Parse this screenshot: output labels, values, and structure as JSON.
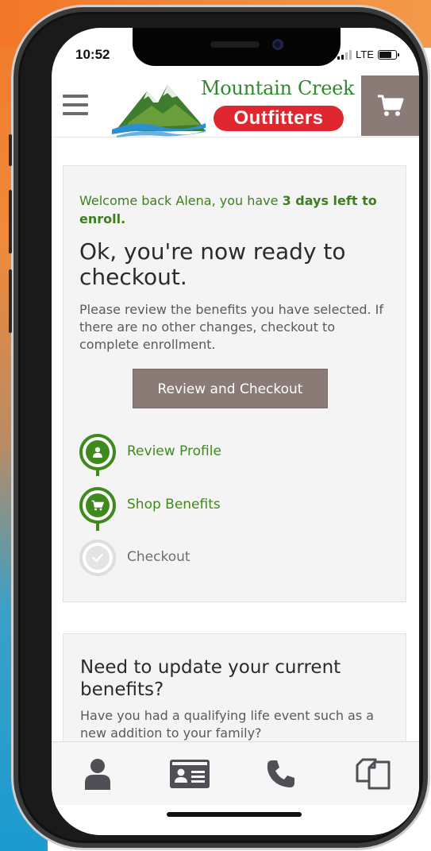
{
  "status_bar": {
    "time": "10:52",
    "network": "LTE"
  },
  "header": {
    "brand_name": "Mountain Creek",
    "brand_sub": "Outfitters",
    "menu_icon": "hamburger-icon",
    "cart_icon": "cart-icon"
  },
  "enroll_card": {
    "welcome_prefix": "Welcome back Alena, you have ",
    "welcome_bold": "3 days left to enroll.",
    "title": "Ok, you're now ready to checkout.",
    "body": "Please review the benefits you have selected. If there are no other changes, checkout to complete enrollment.",
    "button_label": "Review and Checkout",
    "steps": [
      {
        "label": "Review Profile",
        "icon": "user-icon",
        "status": "complete"
      },
      {
        "label": "Shop Benefits",
        "icon": "cart-icon",
        "status": "complete"
      },
      {
        "label": "Checkout",
        "icon": "check-icon",
        "status": "pending"
      }
    ]
  },
  "update_card": {
    "title": "Need to update your current benefits?",
    "body": "Have you had a qualifying life event such as a new addition to your family?"
  },
  "tabbar": {
    "items": [
      {
        "icon": "profile-icon"
      },
      {
        "icon": "id-card-icon"
      },
      {
        "icon": "phone-icon"
      },
      {
        "icon": "documents-icon"
      }
    ]
  },
  "colors": {
    "accent_green": "#3f8a1c",
    "button_taupe": "#8b7b76",
    "brand_red": "#e0272f"
  }
}
